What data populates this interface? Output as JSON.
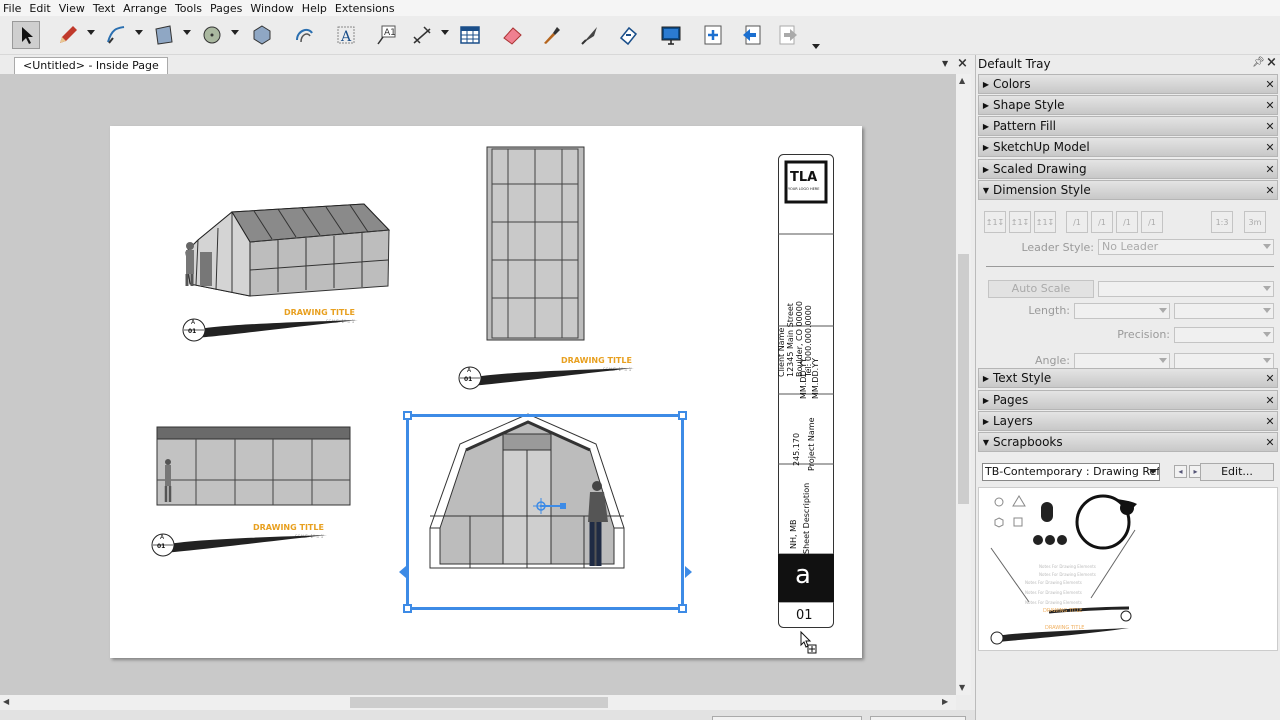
{
  "menu": [
    "File",
    "Edit",
    "View",
    "Text",
    "Arrange",
    "Tools",
    "Pages",
    "Window",
    "Help",
    "Extensions"
  ],
  "toolbar_icons": [
    "select-arrow",
    "pencil",
    "freehand",
    "rectangle",
    "circle",
    "polygon",
    "offset",
    "text",
    "label",
    "dimension",
    "table",
    "eraser",
    "style-eyedropper",
    "split",
    "join",
    "present",
    "add-page",
    "previous-page",
    "next-page",
    "more"
  ],
  "document": {
    "tab_title": "<Untitled> - Inside Page"
  },
  "drawing": {
    "titles": [
      "DRAWING TITLE",
      "DRAWING TITLE",
      "DRAWING TITLE"
    ],
    "scale_text": "SCALE: 1\" = 1'",
    "callout_letter": "A",
    "callout_number": "01",
    "logo": "TLA",
    "logo_sub": "YOUR LOGO HERE",
    "client_name": "Client Name",
    "client_street": "12345 Main Street",
    "client_city": "Boulder, CO 00000",
    "client_tel": "Tel: 000.000.0000",
    "dates": [
      "MM.DD.YY",
      "MM.DD.YY"
    ],
    "project_number": "245.170",
    "project_name": "Project Name",
    "drawn_by": "NH, MB",
    "sheet_description": "Sheet Description",
    "sheet_letter": "a",
    "sheet_number": "01"
  },
  "tray": {
    "title": "Default Tray",
    "panels": [
      {
        "label": "Colors",
        "expanded": false
      },
      {
        "label": "Shape Style",
        "expanded": false
      },
      {
        "label": "Pattern Fill",
        "expanded": false
      },
      {
        "label": "SketchUp Model",
        "expanded": false
      },
      {
        "label": "Scaled Drawing",
        "expanded": false
      },
      {
        "label": "Dimension Style",
        "expanded": true
      },
      {
        "label": "Text Style",
        "expanded": false
      },
      {
        "label": "Pages",
        "expanded": false
      },
      {
        "label": "Layers",
        "expanded": false
      },
      {
        "label": "Scrapbooks",
        "expanded": true
      }
    ],
    "dimension": {
      "leader_style_label": "Leader Style:",
      "leader_style_value": "No Leader",
      "auto_scale_label": "Auto Scale",
      "length_label": "Length:",
      "precision_label": "Precision:",
      "angle_label": "Angle:"
    },
    "scrapbook": {
      "selected": "TB-Contemporary : Drawing Reference",
      "edit_label": "Edit...",
      "notes": [
        "Notes For Drawing Elements",
        "Notes For Drawing Elements",
        "Notes For Drawing Elements",
        "Notes For Drawing Elements",
        "Notes For Drawing Elements"
      ],
      "titles": [
        "DRAWING TITLE",
        "DRAWING TITLE"
      ]
    }
  }
}
